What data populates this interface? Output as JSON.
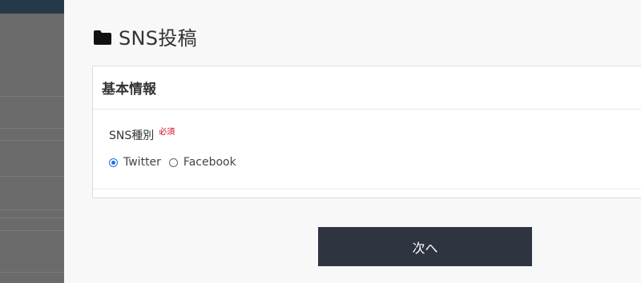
{
  "modal": {
    "title": "SNS投稿",
    "title_icon": "folder-icon"
  },
  "card": {
    "header": "基本情報",
    "field": {
      "label": "SNS種別",
      "required_badge": "必須",
      "options": [
        {
          "label": "Twitter",
          "selected": true
        },
        {
          "label": "Facebook",
          "selected": false
        }
      ]
    }
  },
  "actions": {
    "next_label": "次へ"
  },
  "colors": {
    "accent": "#1a73e8",
    "required": "#d0021b",
    "button_bg": "#2f3441"
  }
}
